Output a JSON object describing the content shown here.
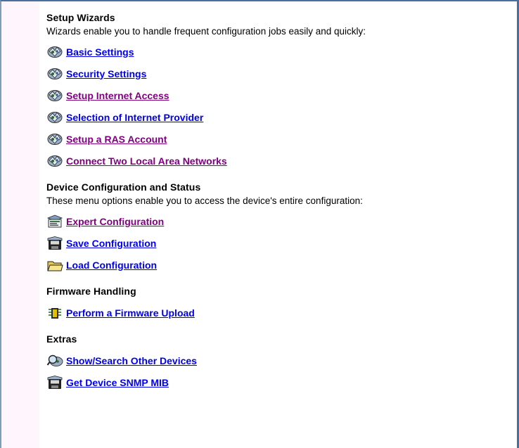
{
  "sections": [
    {
      "title": "Setup Wizards",
      "description": "Wizards enable you to handle frequent configuration jobs easily and quickly:",
      "items": [
        {
          "label": "Basic Settings",
          "icon": "wizard-icon",
          "state": "unvisited"
        },
        {
          "label": "Security Settings",
          "icon": "wizard-icon",
          "state": "unvisited"
        },
        {
          "label": "Setup Internet Access",
          "icon": "wizard-icon",
          "state": "visited"
        },
        {
          "label": "Selection of Internet Provider",
          "icon": "wizard-icon",
          "state": "unvisited"
        },
        {
          "label": "Setup a RAS Account",
          "icon": "wizard-icon",
          "state": "visited"
        },
        {
          "label": "Connect Two Local Area Networks",
          "icon": "wizard-icon",
          "state": "visited"
        }
      ]
    },
    {
      "title": "Device Configuration and Status",
      "description": "These menu options enable you to access the device's entire configuration:",
      "items": [
        {
          "label": "Expert Configuration",
          "icon": "expert-config-icon",
          "state": "visited"
        },
        {
          "label": "Save Configuration",
          "icon": "save-disk-icon",
          "state": "unvisited"
        },
        {
          "label": "Load Configuration",
          "icon": "folder-icon",
          "state": "unvisited"
        }
      ]
    },
    {
      "title": "Firmware Handling",
      "description": "",
      "items": [
        {
          "label": "Perform a Firmware Upload",
          "icon": "firmware-chip-icon",
          "state": "unvisited"
        }
      ]
    },
    {
      "title": "Extras",
      "description": "",
      "items": [
        {
          "label": "Show/Search Other Devices",
          "icon": "search-devices-icon",
          "state": "unvisited"
        },
        {
          "label": "Get Device SNMP MIB",
          "icon": "save-disk-icon",
          "state": "unvisited"
        }
      ]
    }
  ],
  "colors": {
    "link_unvisited": "#0000ee",
    "link_visited": "#800080",
    "frame_border": "#4a6e9e",
    "left_strip": "#fff5fd"
  }
}
